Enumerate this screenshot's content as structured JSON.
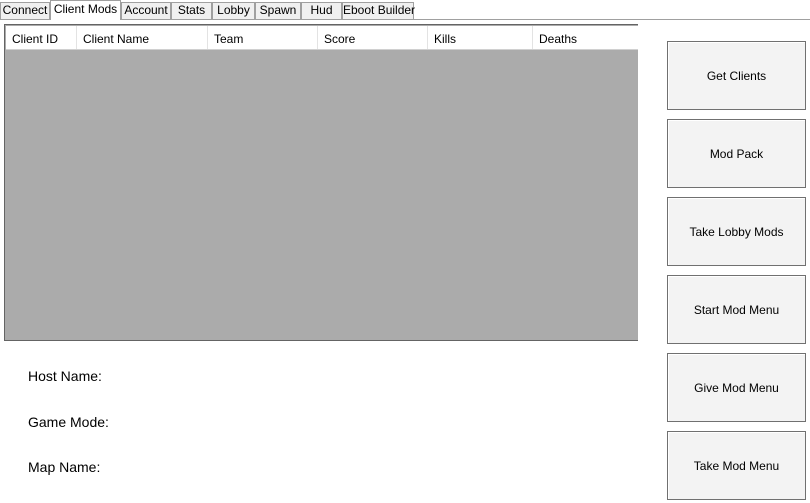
{
  "tabs": [
    {
      "label": "Connect"
    },
    {
      "label": "Client Mods",
      "active": true
    },
    {
      "label": "Account"
    },
    {
      "label": "Stats"
    },
    {
      "label": "Lobby"
    },
    {
      "label": "Spawn"
    },
    {
      "label": "Hud"
    },
    {
      "label": "Eboot Builder"
    }
  ],
  "grid": {
    "columns": [
      "Client ID",
      "Client Name",
      "Team",
      "Score",
      "Kills",
      "Deaths"
    ],
    "rows": []
  },
  "info": {
    "host_name_label": "Host Name:",
    "game_mode_label": "Game Mode:",
    "map_name_label": "Map Name:"
  },
  "buttons": {
    "get_clients": "Get Clients",
    "mod_pack": "Mod Pack",
    "take_lobby_mods": "Take Lobby Mods",
    "start_mod_menu": "Start Mod Menu",
    "give_mod_menu": "Give Mod Menu",
    "take_mod_menu": "Take Mod Menu"
  },
  "colors": {
    "grid_background": "#ababab",
    "button_face": "#f3f3f3",
    "border": "#707070"
  }
}
